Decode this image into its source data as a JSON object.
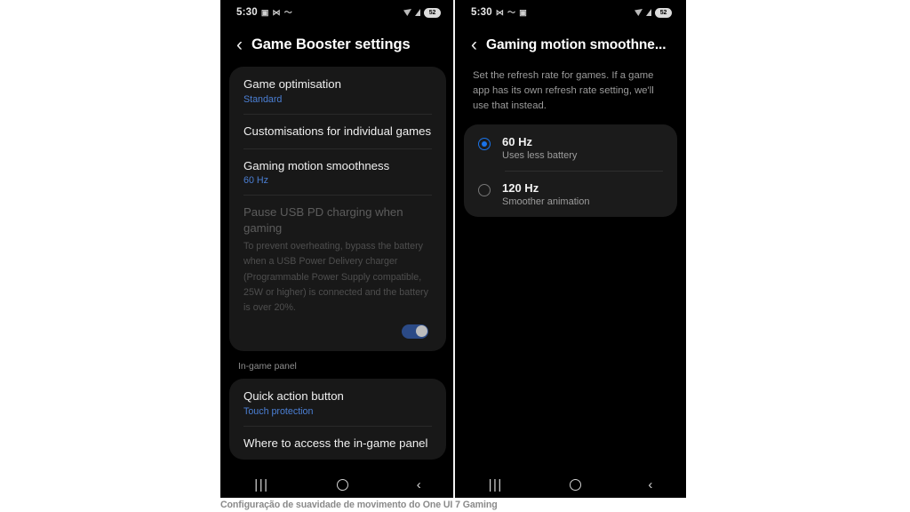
{
  "caption": "Configuração de suavidade de movimento do One UI 7 Gaming",
  "status_bar": {
    "time": "5:30",
    "battery_level": "52",
    "icons": [
      "screenshot-icon",
      "dnd-icon",
      "wave-icon"
    ]
  },
  "left_phone": {
    "header": {
      "back_label": "‹",
      "title": "Game Booster settings"
    },
    "card_main": [
      {
        "title": "Game optimisation",
        "subtitle": "Standard"
      },
      {
        "title": "Customisations for individual games",
        "subtitle": ""
      },
      {
        "title": "Gaming motion smoothness",
        "subtitle": "60 Hz"
      }
    ],
    "disabled_item": {
      "title": "Pause USB PD charging when gaming",
      "body": "To prevent overheating, bypass the battery when a USB Power Delivery charger (Programmable Power Supply compatible, 25W or higher) is connected and the battery is over 20%.",
      "toggle_state": "on"
    },
    "section_label": "In-game panel",
    "card_panel": [
      {
        "title": "Quick action button",
        "subtitle": "Touch protection"
      },
      {
        "title": "Where to access the in-game panel",
        "subtitle": ""
      }
    ],
    "navbar": {
      "recents": "|||",
      "home": "",
      "back": "‹"
    }
  },
  "right_phone": {
    "header": {
      "back_label": "‹",
      "title": "Gaming motion smoothne..."
    },
    "description": "Set the refresh rate for games. If a game app has its own refresh rate setting, we'll use that instead.",
    "options": [
      {
        "title": "60 Hz",
        "subtitle": "Uses less battery",
        "selected": true
      },
      {
        "title": "120 Hz",
        "subtitle": "Smoother animation",
        "selected": false
      }
    ],
    "navbar": {
      "recents": "|||",
      "home": "",
      "back": "‹"
    }
  },
  "colors": {
    "accent_blue": "#4b7fd4",
    "radio_blue": "#1a73e8",
    "background": "#000000",
    "card": "#181818"
  }
}
